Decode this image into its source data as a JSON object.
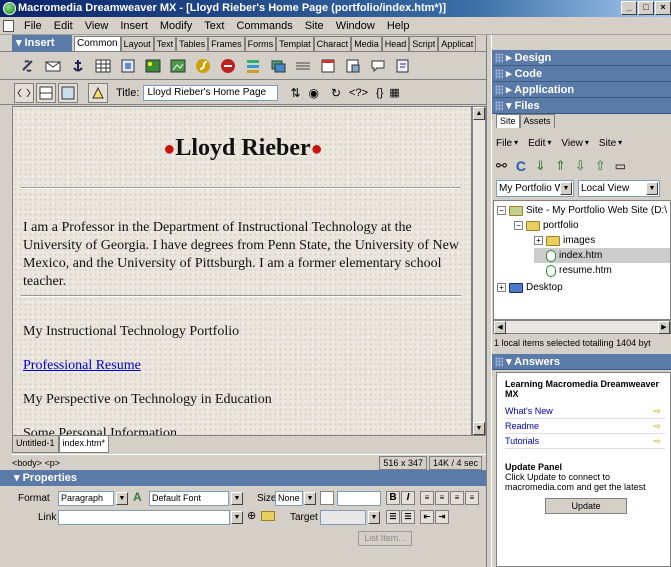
{
  "window": {
    "title": "Macromedia Dreamweaver MX - [Lloyd Rieber's Home Page (portfolio/index.htm*)]"
  },
  "menu": [
    "File",
    "Edit",
    "View",
    "Insert",
    "Modify",
    "Text",
    "Commands",
    "Site",
    "Window",
    "Help"
  ],
  "insert": {
    "title": "Insert",
    "tabs": [
      "Common",
      "Layout",
      "Text",
      "Tables",
      "Frames",
      "Forms",
      "Templat",
      "Charact",
      "Media",
      "Head",
      "Script",
      "Applicat"
    ]
  },
  "doc_toolbar": {
    "title_label": "Title:",
    "title_value": "Lloyd Rieber's Home Page"
  },
  "page": {
    "heading": "Lloyd Rieber",
    "bio": "I am a Professor in the Department of Instructional Technology at the University of Georgia. I have degrees from Penn State, the University of New Mexico, and the University of Pittsburgh. I am a former elementary school teacher.",
    "portfolio": "My Instructional Technology Portfolio",
    "resume_link": "Professional Resume",
    "perspective": "My Perspective on Technology in Education",
    "personal": "Some Personal Information"
  },
  "doc_tabs": [
    "Untitled-1",
    "index.htm*"
  ],
  "status": {
    "tags": "<body> <p>",
    "size": "516 x 347",
    "download": "14K / 4 sec"
  },
  "properties": {
    "title": "Properties",
    "format_label": "Format",
    "format_value": "Paragraph",
    "font_value": "Default Font",
    "size_label": "Size",
    "size_value": "None",
    "link_label": "Link",
    "target_label": "Target",
    "list_item": "List Item..."
  },
  "panels": {
    "design": "Design",
    "code": "Code",
    "application": "Application",
    "files": "Files",
    "answers": "Answers"
  },
  "files": {
    "tabs": [
      "Site",
      "Assets"
    ],
    "menu": [
      "File",
      "Edit",
      "View",
      "Site"
    ],
    "site_select": "My Portfolio We",
    "view_select": "Local View",
    "tree": [
      {
        "label": "Site - My Portfolio Web Site (D:\\",
        "level": 0,
        "type": "site"
      },
      {
        "label": "portfolio",
        "level": 1,
        "type": "folder"
      },
      {
        "label": "images",
        "level": 2,
        "type": "folder"
      },
      {
        "label": "index.htm",
        "level": 2,
        "type": "file",
        "selected": true
      },
      {
        "label": "resume.htm",
        "level": 2,
        "type": "file"
      },
      {
        "label": "Desktop",
        "level": 0,
        "type": "desktop"
      }
    ],
    "status": "1 local items selected totalling 1404 byt"
  },
  "answers": {
    "heading": "Learning Macromedia Dreamweaver MX",
    "links": [
      "What's New",
      "Readme",
      "Tutorials"
    ],
    "update_title": "Update Panel",
    "update_text": "Click Update to connect to macromedia.com and get the latest",
    "update_button": "Update"
  },
  "colors": {
    "titlebar": "#0a246a",
    "panel_header": "#5a7aa8",
    "link": "#0000cc",
    "apple": "#cc1111"
  }
}
